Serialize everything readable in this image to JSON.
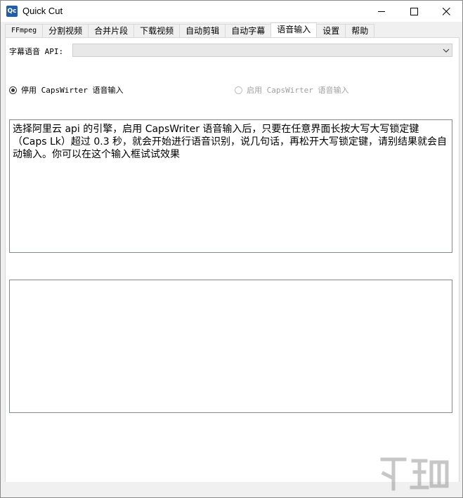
{
  "window": {
    "title": "Quick Cut",
    "app_icon_text": "Qc",
    "controls": [
      "minimize-icon",
      "maximize-icon",
      "close-icon"
    ]
  },
  "tabs": [
    {
      "label": "FFmpeg",
      "active": false
    },
    {
      "label": "分割视频",
      "active": false
    },
    {
      "label": "合并片段",
      "active": false
    },
    {
      "label": "下载视频",
      "active": false
    },
    {
      "label": "自动剪辑",
      "active": false
    },
    {
      "label": "自动字幕",
      "active": false
    },
    {
      "label": "语音输入",
      "active": true
    },
    {
      "label": "设置",
      "active": false
    },
    {
      "label": "帮助",
      "active": false
    }
  ],
  "voice_input": {
    "api_label": "字幕语音 API:",
    "api_selected": "",
    "radio_disable": {
      "label": "停用 CapsWirter 语音输入",
      "checked": true,
      "enabled": true
    },
    "radio_enable": {
      "label": "启用 CapsWirter 语音输入",
      "checked": false,
      "enabled": false
    },
    "instructions_text": "选择阿里云 api 的引擎，启用 CapsWriter 语音输入后，只要在任意界面长按大写大写锁定键（Caps Lk）超过 0.3 秒，就会开始进行语音识别，说几句话，再松开大写锁定键，请别结果就会自动输入。你可以在这个输入框试试效果",
    "test_input_text": ""
  },
  "colors": {
    "app_icon_bg": "#1f5fa8",
    "panel_bg": "#ffffff",
    "window_bg": "#f0f0f0"
  }
}
